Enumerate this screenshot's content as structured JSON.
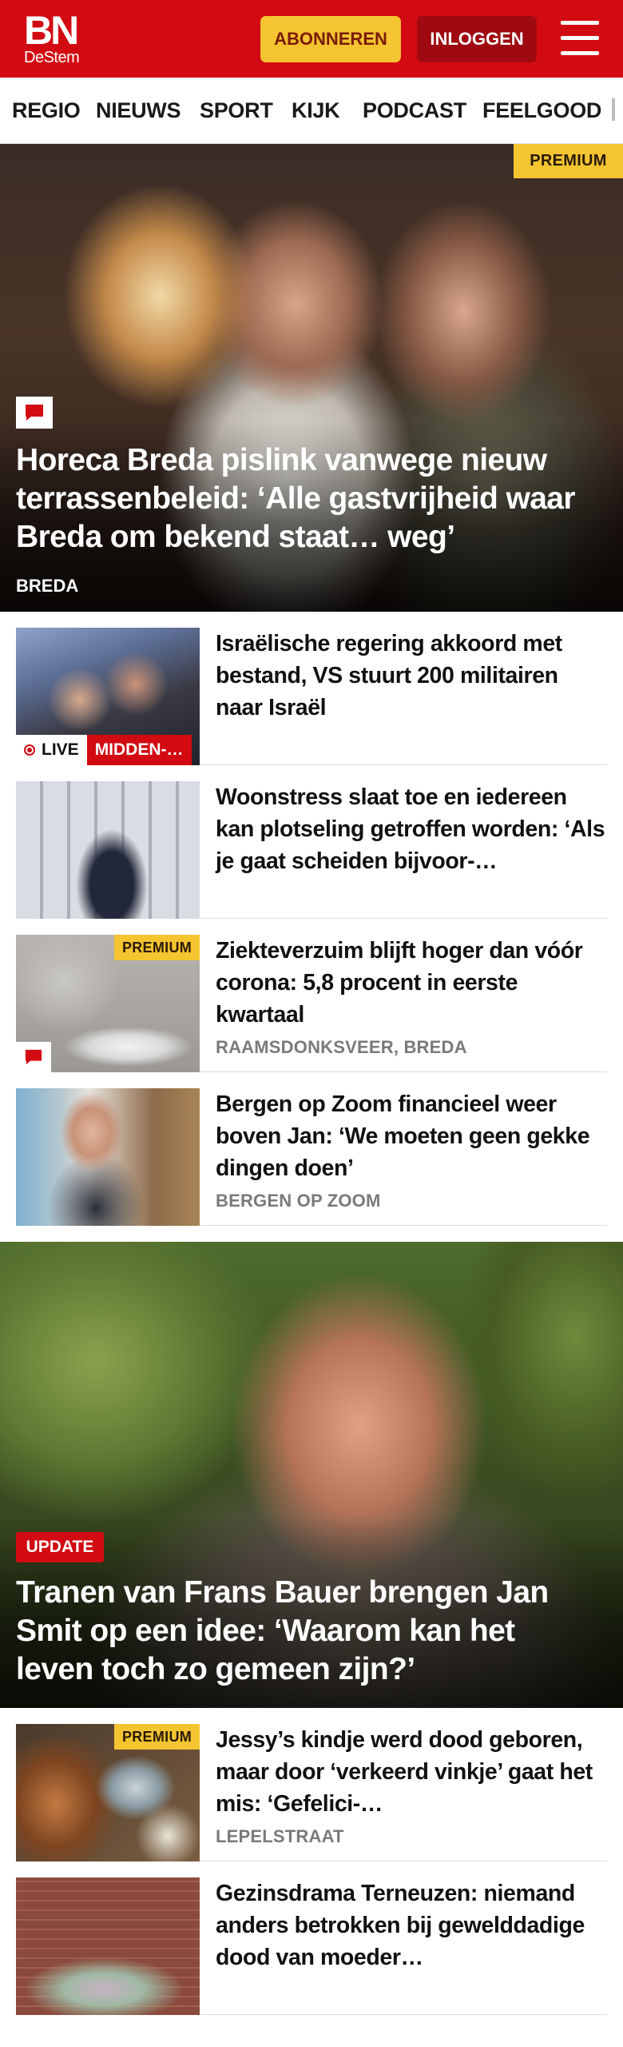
{
  "header": {
    "logo_main": "BN",
    "logo_sub": "DeStem",
    "subscribe_label": "ABONNEREN",
    "login_label": "INLOGGEN"
  },
  "nav": {
    "items": [
      "REGIO",
      "NIEUWS",
      "SPORT",
      "KIJK",
      "PODCAST",
      "FEELGOOD"
    ]
  },
  "hero1": {
    "badge": "PREMIUM",
    "title": "Horeca Breda pislink vanwege nieuw terrassenbeleid: ‘Alle gastvrijheid waar Breda om bekend staat… weg’",
    "label": "BREDA",
    "has_comments": true
  },
  "articles1": [
    {
      "title": "Israëlische regering akkoord met bestand, VS stuurt 200 militairen naar Israël",
      "live_label": "LIVE",
      "category": "MIDDEN-…"
    },
    {
      "title": "Woonstress slaat toe en iedereen kan plotseling getroffen worden: ‘Als je gaat scheiden bijvoor-…"
    },
    {
      "badge": "PREMIUM",
      "title": "Ziekteverzuim blijft hoger dan vóór corona: 5,8 procent in eerste kwartaal",
      "label": "RAAMSDONKSVEER, BREDA",
      "has_comments": true
    },
    {
      "title": "Bergen op Zoom financieel weer boven Jan: ‘We moeten geen gekke dingen doen’",
      "label": "BERGEN OP ZOOM"
    }
  ],
  "hero2": {
    "badge": "UPDATE",
    "title": "Tranen van Frans Bauer brengen Jan Smit op een idee: ‘Waarom kan het leven toch zo gemeen zijn?’"
  },
  "articles2": [
    {
      "badge": "PREMIUM",
      "title": "Jessy’s kindje werd dood geboren, maar door ‘verkeerd vinkje’ gaat het mis: ‘Gefelici-…",
      "label": "LEPELSTRAAT"
    },
    {
      "title": "Gezinsdrama Terneuzen: niemand anders betrokken bij gewelddadige dood van moeder…"
    }
  ],
  "colors": {
    "brand_red": "#d20a11",
    "subscribe_yellow": "#f4c431",
    "login_dark_red": "#9e0a10",
    "label_grey": "#7a7a7a"
  },
  "icons": {
    "menu": "hamburger-menu-icon",
    "comment": "comment-bubble-icon",
    "live": "live-dot-icon"
  }
}
